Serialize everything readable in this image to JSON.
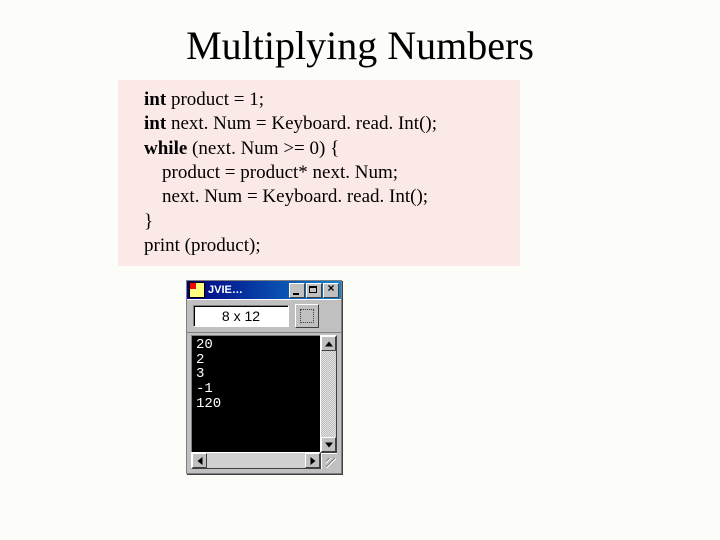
{
  "title": "Multiplying Numbers",
  "code": {
    "l1_kw": "int",
    "l1_rest": " product = 1;",
    "l2_kw": "int",
    "l2_rest": " next. Num = Keyboard. read. Int();",
    "l3_kw": "while",
    "l3_rest": " (next. Num >= 0) {",
    "l4": "product = product* next. Num;",
    "l5": "next. Num = Keyboard. read. Int();",
    "l6": "}",
    "l7": "print (product);"
  },
  "console": {
    "title": "JVIE…",
    "input": "8 x 12",
    "output": [
      "20",
      "2",
      "3",
      "-1",
      "120"
    ]
  }
}
